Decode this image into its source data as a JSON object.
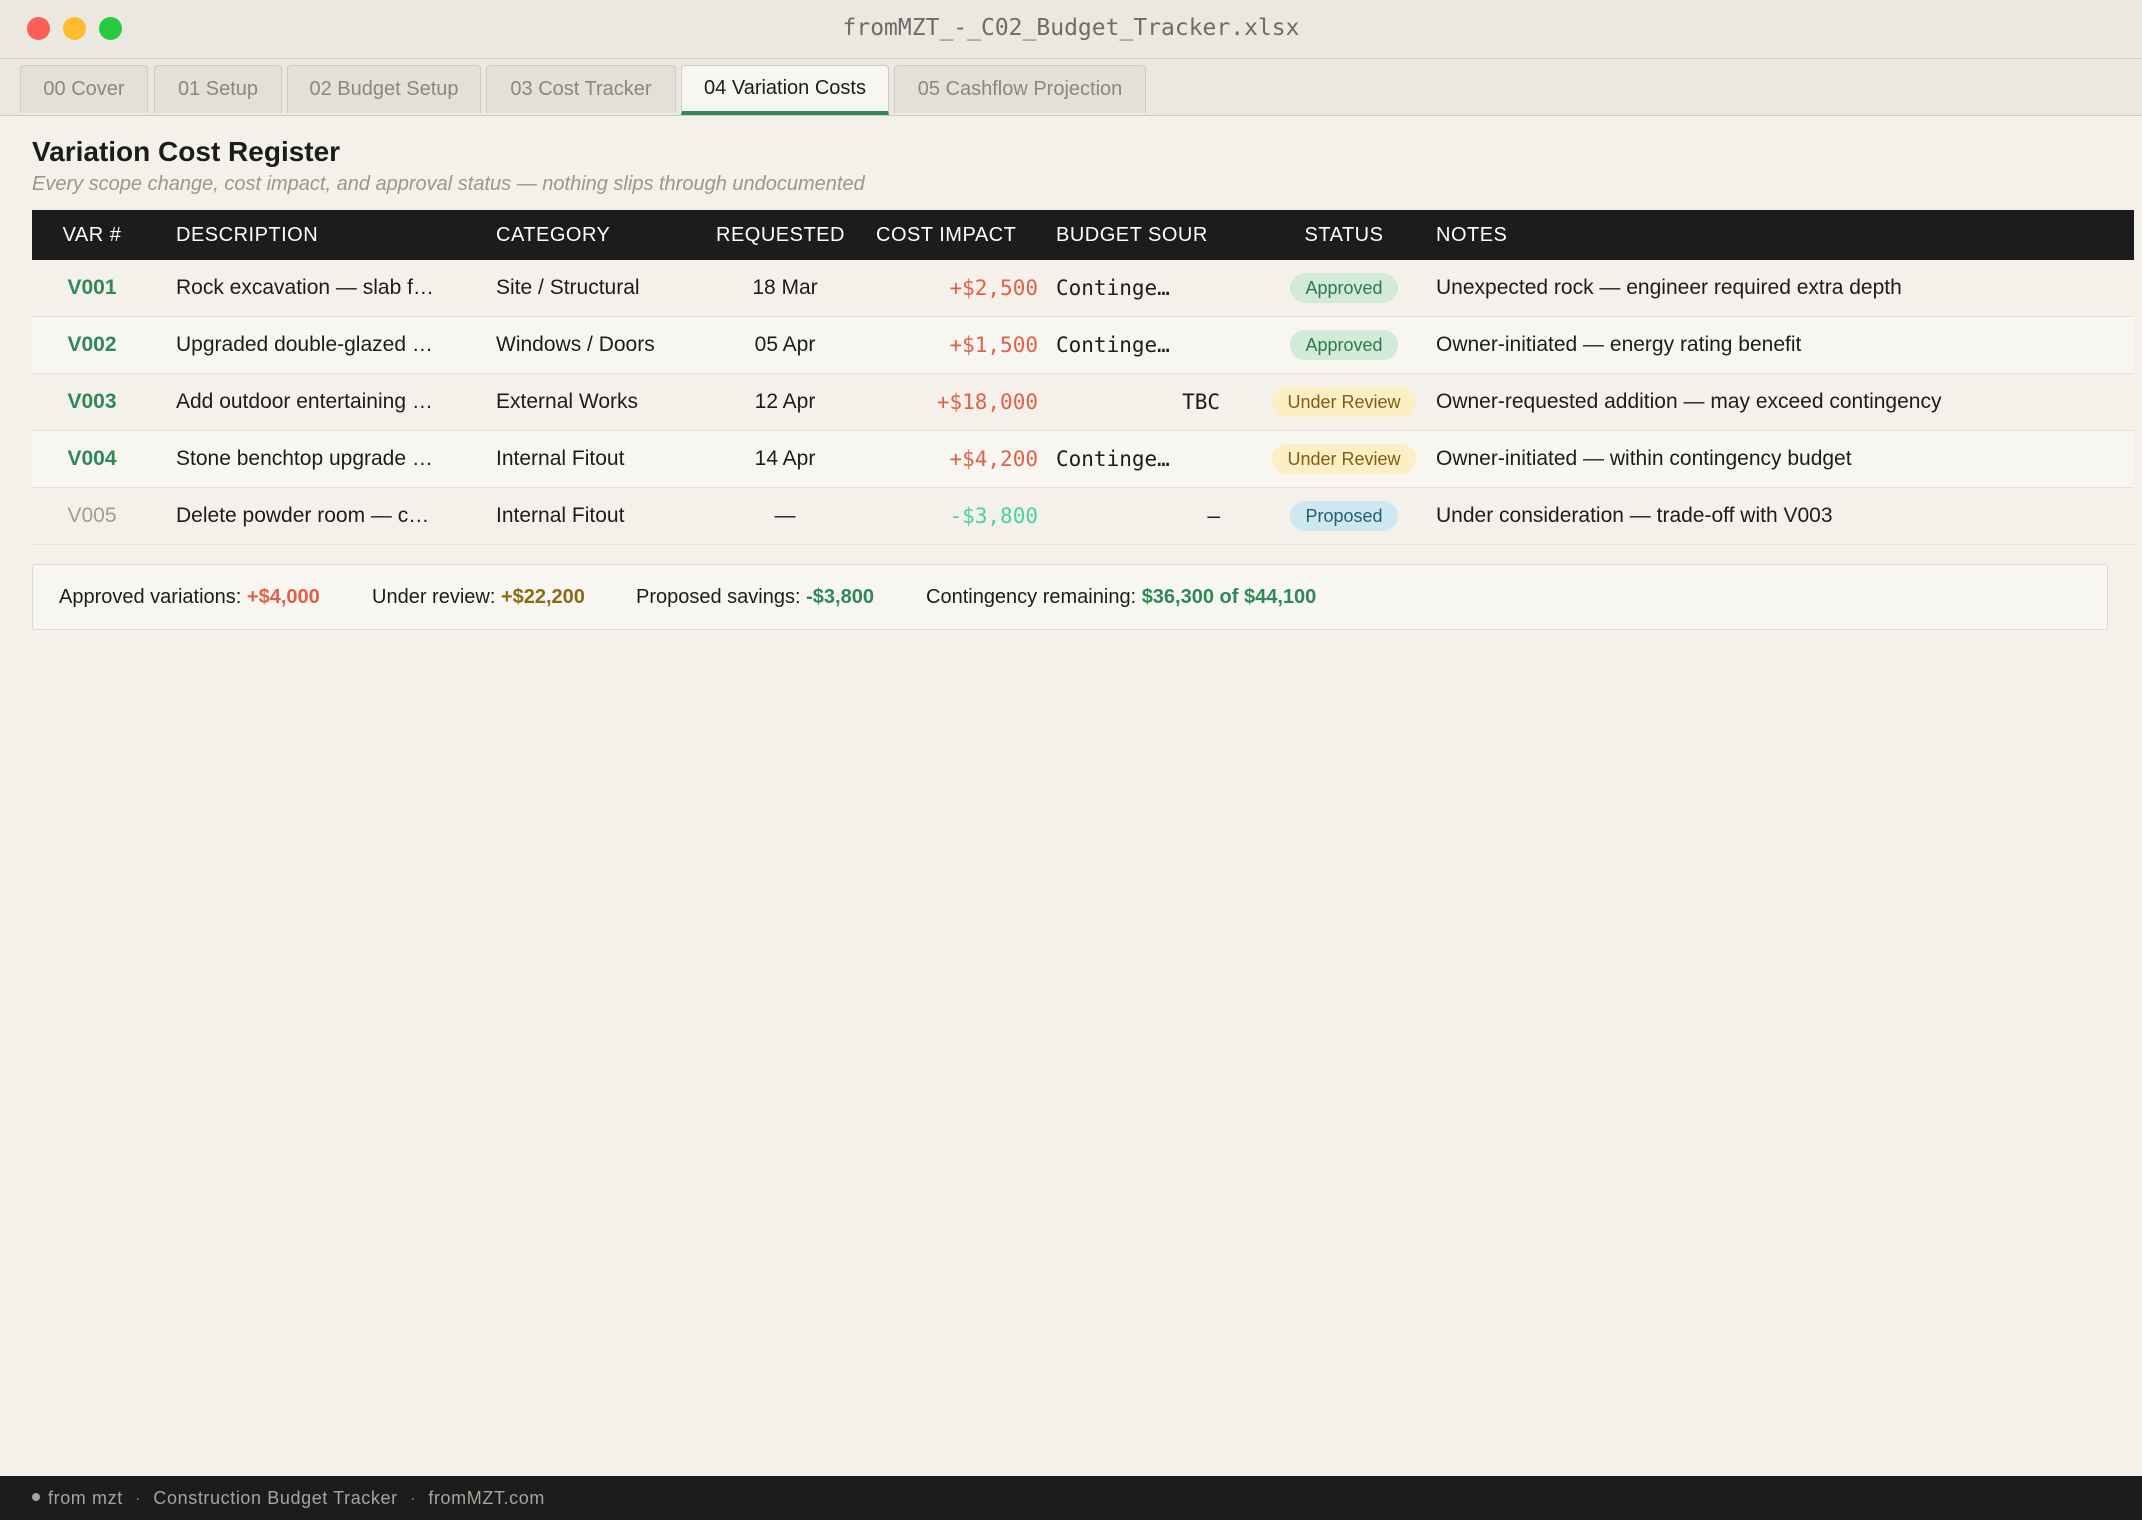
{
  "window": {
    "title": "fromMZT_-_C02_Budget_Tracker.xlsx"
  },
  "tabs": [
    {
      "label": "00 Cover",
      "active": false
    },
    {
      "label": "01 Setup",
      "active": false
    },
    {
      "label": "02 Budget Setup",
      "active": false
    },
    {
      "label": "03 Cost Tracker",
      "active": false
    },
    {
      "label": "04 Variation Costs",
      "active": true
    },
    {
      "label": "05 Cashflow Projection",
      "active": false
    }
  ],
  "page": {
    "title": "Variation Cost Register",
    "subtitle": "Every scope change, cost impact, and approval status — nothing slips through undocumented"
  },
  "table": {
    "headers": {
      "var": "VAR #",
      "description": "DESCRIPTION",
      "category": "CATEGORY",
      "requested": "REQUESTED",
      "cost_impact": "COST IMPACT",
      "budget_source": "BUDGET SOUR",
      "status": "STATUS",
      "notes": "NOTES"
    },
    "rows": [
      {
        "var": "V001",
        "description": "Rock excavation — slab f…",
        "category": "Site / Structural",
        "requested": "18 Mar",
        "cost_impact": "+$2,500",
        "budget_source": "Continge…",
        "status": "Approved",
        "notes": "Unexpected rock — engineer required extra depth"
      },
      {
        "var": "V002",
        "description": "Upgraded double-glazed …",
        "category": "Windows / Doors",
        "requested": "05 Apr",
        "cost_impact": "+$1,500",
        "budget_source": "Continge…",
        "status": "Approved",
        "notes": "Owner-initiated — energy rating benefit"
      },
      {
        "var": "V003",
        "description": "Add outdoor entertaining …",
        "category": "External Works",
        "requested": "12 Apr",
        "cost_impact": "+$18,000",
        "budget_source": "TBC",
        "status": "Under Review",
        "notes": "Owner-requested addition — may exceed contingency"
      },
      {
        "var": "V004",
        "description": "Stone benchtop upgrade …",
        "category": "Internal Fitout",
        "requested": "14 Apr",
        "cost_impact": "+$4,200",
        "budget_source": "Continge…",
        "status": "Under Review",
        "notes": "Owner-initiated — within contingency budget"
      },
      {
        "var": "V005",
        "description": "Delete powder room — c…",
        "category": "Internal Fitout",
        "requested": "—",
        "cost_impact": "-$3,800",
        "budget_source": "–",
        "status": "Proposed",
        "notes": "Under consideration — trade-off with V003"
      }
    ]
  },
  "summary": {
    "approved_label": "Approved variations:",
    "approved_value": "+$4,000",
    "review_label": "Under review:",
    "review_value": "+$22,200",
    "savings_label": "Proposed savings:",
    "savings_value": "-$3,800",
    "contingency_label": "Contingency remaining:",
    "contingency_value": "$36,300 of $44,100"
  },
  "footer": {
    "brand": "from mzt",
    "product": "Construction Budget Tracker",
    "site": "fromMZT.com"
  },
  "colors": {
    "accent_green": "#2d8a55",
    "cost_red": "#e2604a",
    "savings_teal": "#46d1a7",
    "header_dark": "#1c1c1c"
  }
}
